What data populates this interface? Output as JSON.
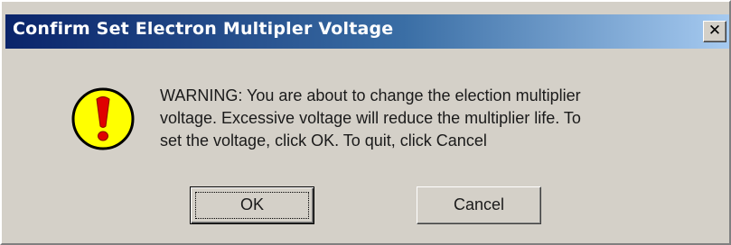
{
  "window": {
    "title": "Confirm Set Electron Multipler Voltage",
    "close_label": "✕"
  },
  "dialog": {
    "icon": "warning-exclamation-icon",
    "message_lines": [
      "WARNING: You are about to change the election multiplier",
      "voltage. Excessive voltage will reduce the multiplier life. To",
      "set the voltage, click OK. To quit, click Cancel"
    ],
    "ok_label": "OK",
    "cancel_label": "Cancel"
  },
  "colors": {
    "icon_fill": "#ffff00",
    "icon_mark": "#e00000",
    "titlebar_start": "#0a246a",
    "titlebar_end": "#a6caf0"
  }
}
